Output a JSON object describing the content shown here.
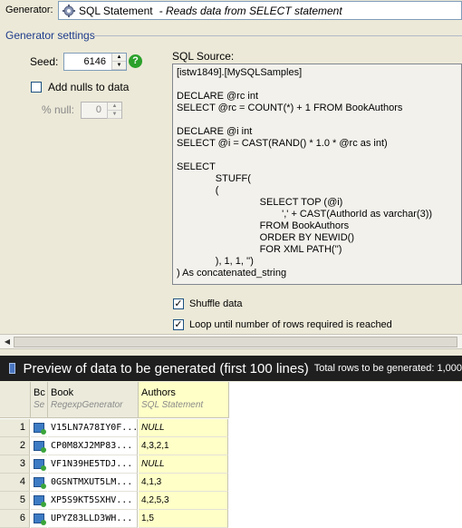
{
  "generator": {
    "label": "Generator:",
    "icon": "gear-icon",
    "name": "SQL Statement",
    "description": "- Reads data from SELECT statement"
  },
  "settings": {
    "header": "Generator settings",
    "seed_label": "Seed:",
    "seed_value": "6146",
    "add_nulls_label": "Add nulls to data",
    "add_nulls_checked": false,
    "percent_null_label": "% null:",
    "percent_null_value": "0",
    "help_icon": "?"
  },
  "sql": {
    "label": "SQL Source:",
    "text": "[istw1849].[MySQLSamples]\n\nDECLARE @rc int\nSELECT @rc = COUNT(*) + 1 FROM BookAuthors\n\nDECLARE @i int\nSELECT @i = CAST(RAND() * 1.0 * @rc as int)\n\nSELECT\n              STUFF(\n              (\n                              SELECT TOP (@i)\n                                      ',' + CAST(AuthorId as varchar(3))\n                              FROM BookAuthors\n                              ORDER BY NEWID()\n                              FOR XML PATH('')\n              ), 1, 1, '')\n) As concatenated_string"
  },
  "options": {
    "shuffle_label": "Shuffle data",
    "shuffle_checked": true,
    "loop_label": "Loop until number of rows required is reached",
    "loop_checked": true
  },
  "preview": {
    "title": "Preview of data to be generated (first 100 lines)",
    "total_label": "Total rows to be generated: 1,000"
  },
  "grid": {
    "columns": [
      {
        "title": "Bc",
        "subtitle": "Se"
      },
      {
        "title": "Book",
        "subtitle": "RegexpGenerator"
      },
      {
        "title": "Authors",
        "subtitle": "SQL Statement"
      }
    ],
    "rows": [
      {
        "n": "1",
        "book": "V15LN7A78IY0F...",
        "authors": "NULL"
      },
      {
        "n": "2",
        "book": "CP0M8XJ2MP83...",
        "authors": "4,3,2,1"
      },
      {
        "n": "3",
        "book": "VF1N39HE5TDJ...",
        "authors": "NULL"
      },
      {
        "n": "4",
        "book": "0GSNTMXUT5LM...",
        "authors": "4,1,3"
      },
      {
        "n": "5",
        "book": "XP5S9KT5SXHV...",
        "authors": "4,2,5,3"
      },
      {
        "n": "6",
        "book": "UPYZ83LLD3WH...",
        "authors": "1,5"
      }
    ]
  }
}
